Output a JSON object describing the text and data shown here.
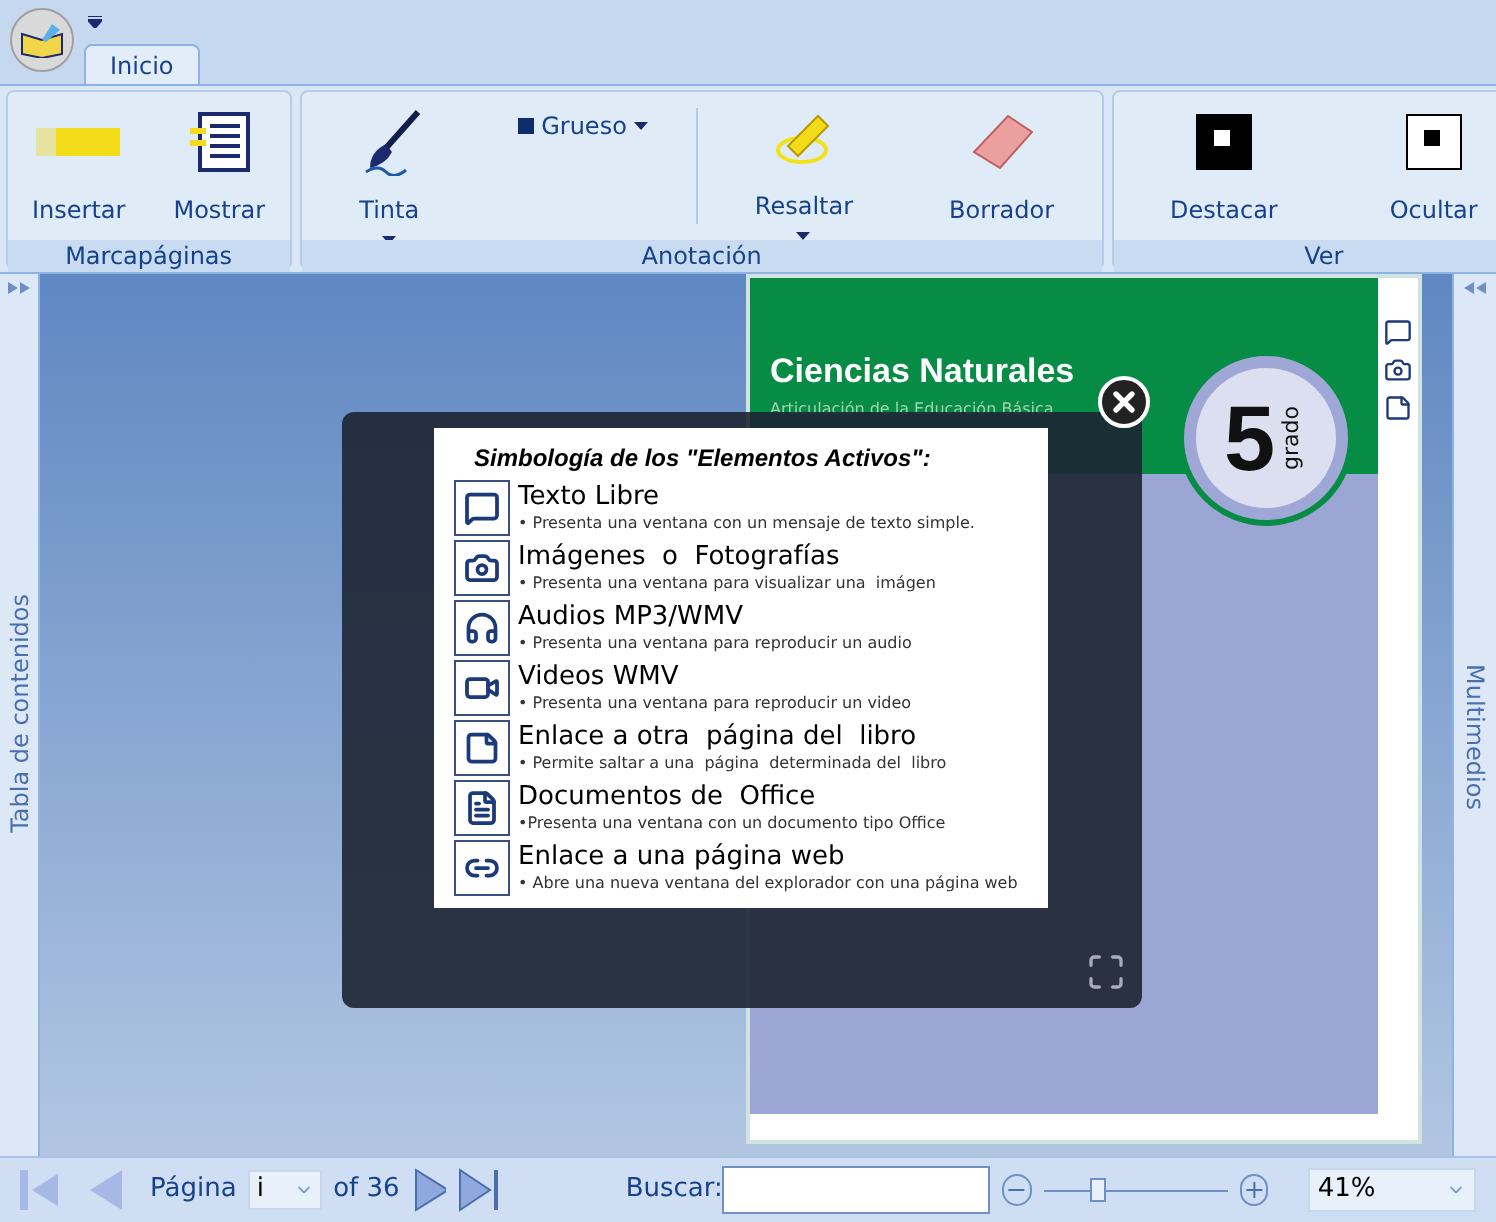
{
  "tabs": [
    {
      "label": "Inicio",
      "selected": true
    }
  ],
  "ribbon_groups": [
    {
      "label": "Marcapáginas",
      "buttons": [
        {
          "label": "Insertar",
          "kind": "highlight-bar"
        },
        {
          "label": "Mostrar",
          "kind": "list"
        }
      ]
    },
    {
      "label": "Anotación",
      "buttons": [
        {
          "label": "Tinta",
          "kind": "brush",
          "dropdown": true
        },
        {
          "label": "Grueso",
          "kind": "thickness",
          "dropdown": true
        },
        {
          "label": "Resaltar",
          "kind": "highlighter",
          "dropdown": true
        },
        {
          "label": "Borrador",
          "kind": "eraser",
          "dropdown": false
        }
      ]
    },
    {
      "label": "Ver",
      "buttons": [
        {
          "label": "Destacar",
          "kind": "show-filled"
        },
        {
          "label": "Ocultar",
          "kind": "show-empty"
        }
      ]
    }
  ],
  "left_panel": {
    "label": "Tabla de contenidos"
  },
  "right_panel": {
    "label": "Multimedios"
  },
  "page": {
    "title": "Ciencias Naturales",
    "subtitle": "Articulación de la Educación Básica",
    "grade_number": "5",
    "grade_word": "grado"
  },
  "legend": {
    "title": "Simbología de los \"Elementos Activos\":",
    "items": [
      {
        "kind": "text",
        "title": "Texto Libre",
        "description": "• Presenta una ventana con un mensaje de texto simple."
      },
      {
        "kind": "image",
        "title": "Imágenes  o  Fotografías",
        "description": "• Presenta una ventana para visualizar una  imágen"
      },
      {
        "kind": "audio",
        "title": "Audios MP3/WMV",
        "description": "• Presenta una ventana para reproducir un audio"
      },
      {
        "kind": "video",
        "title": "Videos WMV",
        "description": "• Presenta una ventana para reproducir un video"
      },
      {
        "kind": "page-link",
        "title": "Enlace a otra  página del  libro",
        "description": "• Permite saltar a una  página  determinada del  libro"
      },
      {
        "kind": "document",
        "title": "Documentos de  Office",
        "description": "•Presenta una ventana con un documento tipo Office"
      },
      {
        "kind": "web-link",
        "title": "Enlace a una página web",
        "description": "• Abre una nueva ventana del explorador con una página web"
      }
    ]
  },
  "status_bar": {
    "page_label": "Página",
    "page_value": "i",
    "page_total": "of 36",
    "search_label": "Buscar:",
    "zoom": {
      "level": 0.3
    },
    "zoom_value": "41%"
  }
}
